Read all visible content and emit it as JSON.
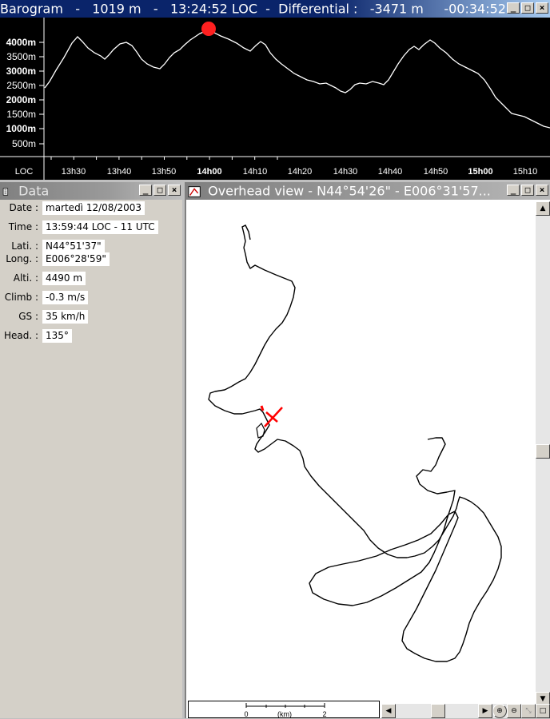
{
  "barogram": {
    "title_prefix": "Barogram",
    "title_alt": "1019 m",
    "title_time": "13:24:52 LOC",
    "title_diff_label": "Differential :",
    "title_diff_alt": "-3471 m",
    "title_diff_time": "-00:34:52",
    "y_labels": [
      "4000m",
      "3500m",
      "3000m",
      "2500m",
      "2000m",
      "1500m",
      "1000m",
      "500m"
    ],
    "x_axis_label": "LOC",
    "x_labels": [
      "13h30",
      "13h40",
      "13h50",
      "14h00",
      "14h10",
      "14h20",
      "14h30",
      "14h40",
      "14h50",
      "15h00",
      "15h10"
    ],
    "bold_x_labels": [
      "14h00",
      "15h00"
    ],
    "marker_color": "#ff2020",
    "line_color": "#ffffff"
  },
  "data_window": {
    "title": "Data",
    "rows": [
      {
        "label": "Date :",
        "value": "martedì 12/08/2003"
      },
      {
        "label": "Time :",
        "value": "13:59:44 LOC  -  11 UTC"
      },
      {
        "label": "Lati. :",
        "value": "N44°51'37\""
      },
      {
        "label": "Long. :",
        "value": "E006°28'59\""
      },
      {
        "label": "Alti. :",
        "value": "4490 m"
      },
      {
        "label": "Climb :",
        "value": "-0.3 m/s"
      },
      {
        "label": "GS :",
        "value": "35 km/h"
      },
      {
        "label": "Head. :",
        "value": "135°"
      }
    ]
  },
  "overhead_window": {
    "title": "Overhead view  -  N44°54'26\" - E006°31'57...",
    "scale_labels": [
      "0",
      "(km)",
      "2"
    ],
    "track_color": "#000000",
    "glider_color": "#ff0000"
  },
  "window_buttons": [
    "_",
    "□",
    "×"
  ]
}
